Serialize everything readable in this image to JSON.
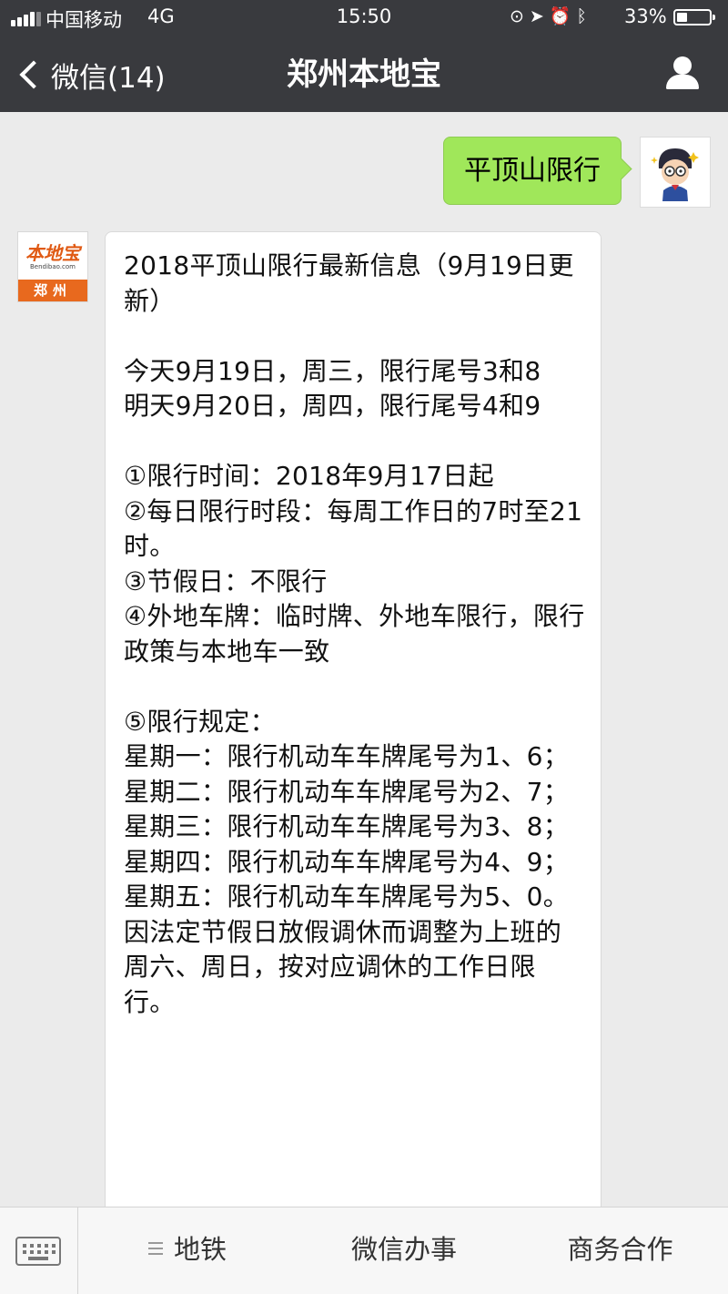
{
  "status_bar": {
    "carrier": "中国移动",
    "network": "4G",
    "time": "15:50",
    "battery": "33%",
    "battery_level": 0.33
  },
  "nav": {
    "back_label": "微信(14)",
    "title": "郑州本地宝"
  },
  "messages": {
    "sent": "平顶山限行",
    "official_logo": {
      "cn": "本地宝",
      "en": "Bendibao.com",
      "city": "郑州"
    },
    "received": "2018平顶山限行最新信息（9月19日更新）\n\n今天9月19日，周三，限行尾号3和8\n明天9月20日，周四，限行尾号4和9\n\n①限行时间：2018年9月17日起\n②每日限行时段：每周工作日的7时至21时。\n③节假日：不限行\n④外地车牌：临时牌、外地车限行，限行政策与本地车一致\n\n⑤限行规定：\n星期一：限行机动车车牌尾号为1、6；\n星期二：限行机动车车牌尾号为2、7；\n星期三：限行机动车车牌尾号为3、8；\n星期四：限行机动车车牌尾号为4、9；\n星期五：限行机动车车牌尾号为5、0。\n因法定节假日放假调休而调整为上班的周六、周日，按对应调休的工作日限行。"
  },
  "bottom_menu": {
    "items": [
      "地铁",
      "微信办事",
      "商务合作"
    ]
  },
  "icons": {
    "back": "chevron-left-icon",
    "profile": "person-icon",
    "keyboard": "keyboard-icon",
    "menu": "menu-lines-icon"
  },
  "colors": {
    "nav_bg": "#393a3e",
    "chat_bg": "#ebebeb",
    "sent_bubble": "#a0e75a",
    "brand_orange": "#e8691e"
  }
}
